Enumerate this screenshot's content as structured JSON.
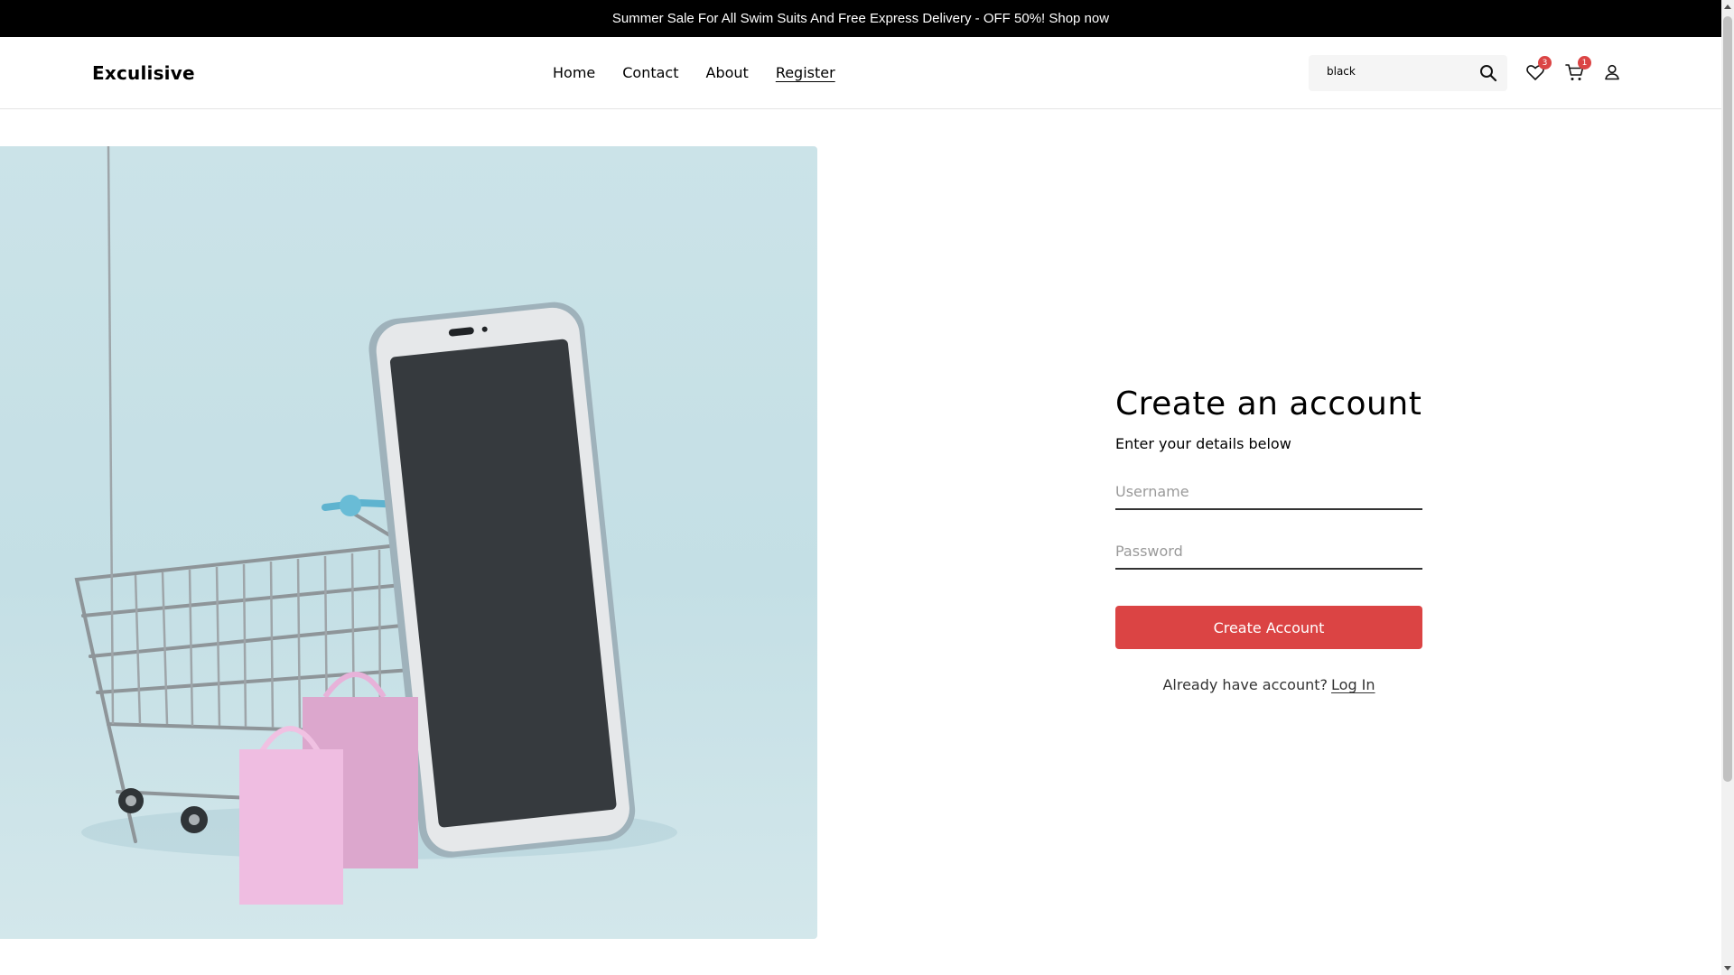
{
  "promo": {
    "text": "Summer Sale For All Swim Suits And Free Express Delivery - OFF 50%! Shop now"
  },
  "header": {
    "logo": "Exculisive",
    "nav": [
      "Home",
      "Contact",
      "About",
      "Register"
    ],
    "active_nav": "Register",
    "search": {
      "value": "black",
      "icon": "search-icon"
    },
    "wishlist": {
      "icon": "heart-icon",
      "count": "3"
    },
    "cart": {
      "icon": "cart-icon",
      "count": "1"
    },
    "account": {
      "icon": "user-icon"
    }
  },
  "hero": {
    "image": "shopping-cart-with-smartphone-and-pink-bags"
  },
  "form": {
    "title": "Create an account",
    "subtitle": "Enter your details below",
    "username_placeholder": "Username",
    "password_placeholder": "Password",
    "submit_label": "Create Account",
    "login_prompt": "Already have account?",
    "login_link": "Log In"
  },
  "colors": {
    "accent": "#db4444",
    "promo_bg": "#000000",
    "hero_bg": "#c8e1e6"
  }
}
